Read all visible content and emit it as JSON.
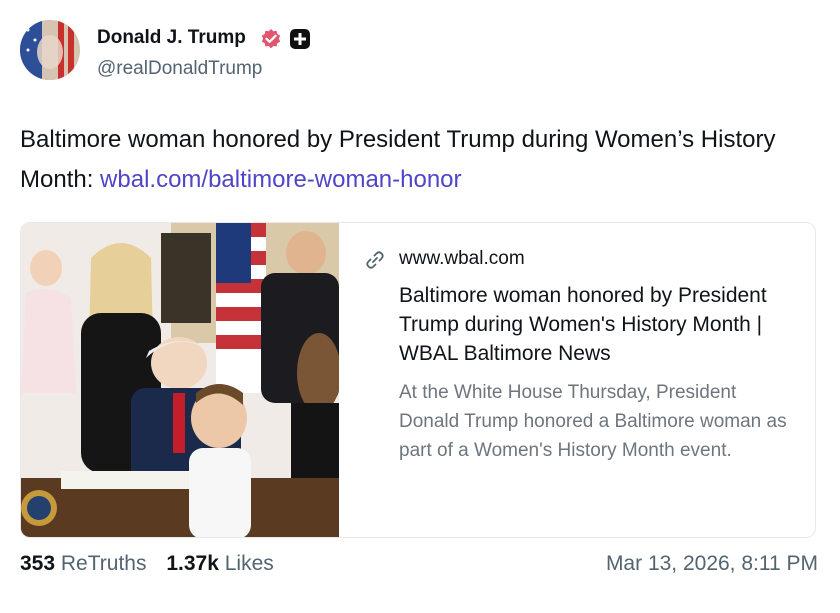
{
  "author": {
    "name": "Donald J. Trump",
    "handle": "@realDonaldTrump",
    "avatar_icon": "avatar-image",
    "verified_icon": "verified-badge-icon",
    "plus_icon": "plus-badge-icon"
  },
  "post": {
    "text": "Baltimore woman honored by President Trump during Women’s History Month: ",
    "link_text": "wbal.com/baltimore-woman-honor"
  },
  "card": {
    "domain": "www.wbal.com",
    "title": "Baltimore woman honored by President Trump during Women's History Month | WBAL Baltimore News",
    "description": "At the White House Thursday, President Donald Trump honored a Baltimore woman as part of a Women's History Month event.",
    "image_alt": "president signing document at White House event"
  },
  "stats": {
    "retruths_count": "353",
    "retruths_label": "ReTruths",
    "likes_count": "1.37k",
    "likes_label": "Likes"
  },
  "timestamp": "Mar 13, 2026, 8:11 PM",
  "colors": {
    "link": "#5045c7",
    "verified": "#e3566f",
    "muted": "#536471"
  }
}
